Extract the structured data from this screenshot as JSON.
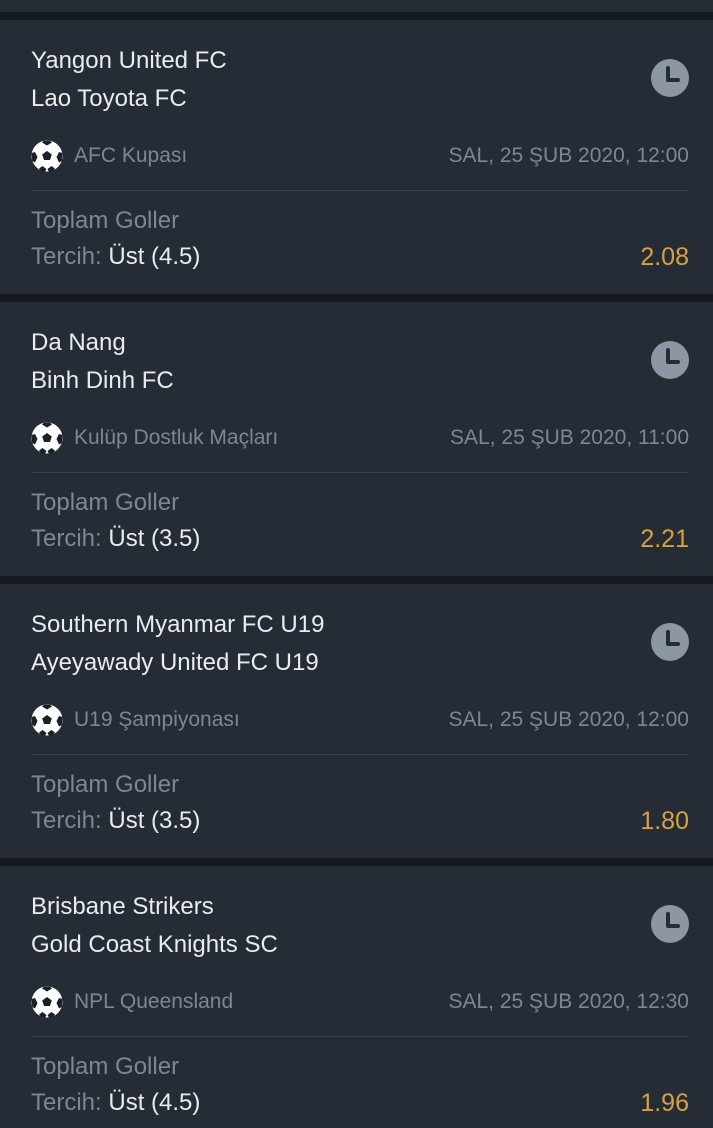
{
  "colors": {
    "background": "#15181d",
    "card": "#262c36",
    "text_primary": "#e9ebee",
    "text_secondary": "#7d8794",
    "odds": "#d7a23e",
    "clock_icon": "#8d96a3"
  },
  "icons": {
    "status": "clock-icon",
    "sport": "soccer-ball-icon"
  },
  "bets": [
    {
      "home": "Yangon United FC",
      "away": "Lao Toyota FC",
      "league": "AFC Kupası",
      "datetime": "SAL, 25 ŞUB 2020, 12:00",
      "market": "Toplam Goller",
      "pick_label": "Tercih:",
      "pick_value": "Üst (4.5)",
      "odds": "2.08"
    },
    {
      "home": "Da Nang",
      "away": "Binh Dinh FC",
      "league": "Kulüp Dostluk Maçları",
      "datetime": "SAL, 25 ŞUB 2020, 11:00",
      "market": "Toplam Goller",
      "pick_label": "Tercih:",
      "pick_value": "Üst (3.5)",
      "odds": "2.21"
    },
    {
      "home": "Southern Myanmar FC U19",
      "away": "Ayeyawady United FC U19",
      "league": "U19 Şampiyonası",
      "datetime": "SAL, 25 ŞUB 2020, 12:00",
      "market": "Toplam Goller",
      "pick_label": "Tercih:",
      "pick_value": "Üst (3.5)",
      "odds": "1.80"
    },
    {
      "home": "Brisbane Strikers",
      "away": "Gold Coast Knights SC",
      "league": "NPL Queensland",
      "datetime": "SAL, 25 ŞUB 2020, 12:30",
      "market": "Toplam Goller",
      "pick_label": "Tercih:",
      "pick_value": "Üst (4.5)",
      "odds": "1.96"
    }
  ]
}
